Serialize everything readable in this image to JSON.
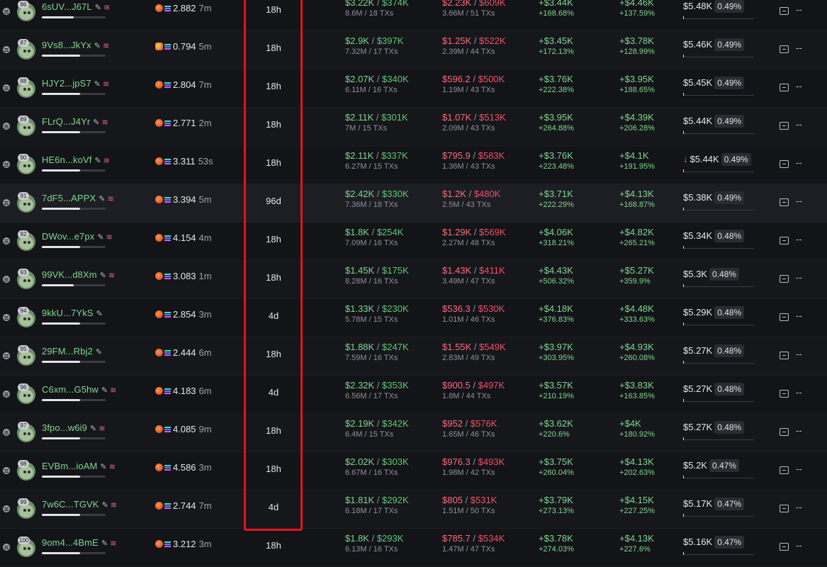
{
  "rows": [
    {
      "rank": "86",
      "wallet": "6sUV...J67L",
      "stack": true,
      "bar_pct": 0.5,
      "balance": "2.882",
      "balance_icon": "orange",
      "last_active": "7m",
      "holding": "18h",
      "bought": "$3.22K",
      "bought_total": "$374K",
      "bought_sub": "8.6M / 18 TXs",
      "sold": "$2.23K",
      "sold_total": "$609K",
      "sold_sub": "3.66M / 51 TXs",
      "pnl": "+$3.44K",
      "pnl_pct": "+168.68%",
      "pnl2": "+$4.46K",
      "pnl2_pct": "+137.59%",
      "mc_arrow": "",
      "mc": "$5.48K",
      "mc_pct": "0.49%"
    },
    {
      "rank": "87",
      "wallet": "9Vs8...JkYx",
      "stack": true,
      "bar_pct": 0.6,
      "balance": "0.794",
      "balance_icon": "multi",
      "last_active": "5m",
      "holding": "18h",
      "bought": "$2.9K",
      "bought_total": "$397K",
      "bought_sub": "7.32M / 17 TXs",
      "sold": "$1.25K",
      "sold_total": "$522K",
      "sold_sub": "2.39M / 44 TXs",
      "pnl": "+$3.45K",
      "pnl_pct": "+172.13%",
      "pnl2": "+$3.78K",
      "pnl2_pct": "+128.99%",
      "mc_arrow": "",
      "mc": "$5.46K",
      "mc_pct": "0.49%"
    },
    {
      "rank": "88",
      "wallet": "HJY2...jpS7",
      "stack": true,
      "bar_pct": 0.6,
      "balance": "2.804",
      "balance_icon": "orange",
      "last_active": "7m",
      "holding": "18h",
      "bought": "$2.07K",
      "bought_total": "$340K",
      "bought_sub": "6.11M / 16 TXs",
      "sold": "$596.2",
      "sold_total": "$500K",
      "sold_sub": "1.19M / 43 TXs",
      "pnl": "+$3.76K",
      "pnl_pct": "+222.38%",
      "pnl2": "+$3.95K",
      "pnl2_pct": "+188.65%",
      "mc_arrow": "",
      "mc": "$5.45K",
      "mc_pct": "0.49%"
    },
    {
      "rank": "89",
      "wallet": "FLrQ...J4Yr",
      "stack": true,
      "bar_pct": 0.6,
      "balance": "2.771",
      "balance_icon": "orange",
      "last_active": "2m",
      "holding": "18h",
      "bought": "$2.11K",
      "bought_total": "$301K",
      "bought_sub": "7M / 15 TXs",
      "sold": "$1.07K",
      "sold_total": "$513K",
      "sold_sub": "2.09M / 43 TXs",
      "pnl": "+$3.95K",
      "pnl_pct": "+264.88%",
      "pnl2": "+$4.39K",
      "pnl2_pct": "+206.28%",
      "mc_arrow": "",
      "mc": "$5.44K",
      "mc_pct": "0.49%"
    },
    {
      "rank": "90",
      "wallet": "HE6n...koVf",
      "stack": true,
      "bar_pct": 0.6,
      "balance": "3.311",
      "balance_icon": "orange",
      "last_active": "53s",
      "holding": "18h",
      "bought": "$2.11K",
      "bought_total": "$337K",
      "bought_sub": "6.27M / 15 TXs",
      "sold": "$795.9",
      "sold_total": "$583K",
      "sold_sub": "1.36M / 43 TXs",
      "pnl": "+$3.76K",
      "pnl_pct": "+223.48%",
      "pnl2": "+$4.1K",
      "pnl2_pct": "+191.95%",
      "mc_arrow": "↓",
      "mc": "$5.44K",
      "mc_pct": "0.49%"
    },
    {
      "rank": "91",
      "wallet": "7dF5...APPX",
      "stack": true,
      "bar_pct": 0.6,
      "balance": "3.394",
      "balance_icon": "orange",
      "last_active": "5m",
      "holding": "96d",
      "bought": "$2.42K",
      "bought_total": "$330K",
      "bought_sub": "7.36M / 18 TXs",
      "sold": "$1.2K",
      "sold_total": "$480K",
      "sold_sub": "2.5M / 43 TXs",
      "pnl": "+$3.71K",
      "pnl_pct": "+222.29%",
      "pnl2": "+$4.13K",
      "pnl2_pct": "+168.87%",
      "mc_arrow": "",
      "mc": "$5.38K",
      "mc_pct": "0.49%"
    },
    {
      "rank": "92",
      "wallet": "DWov...e7px",
      "stack": true,
      "bar_pct": 0.6,
      "balance": "4.154",
      "balance_icon": "orange",
      "last_active": "4m",
      "holding": "18h",
      "bought": "$1.8K",
      "bought_total": "$254K",
      "bought_sub": "7.09M / 16 TXs",
      "sold": "$1.29K",
      "sold_total": "$569K",
      "sold_sub": "2.27M / 48 TXs",
      "pnl": "+$4.06K",
      "pnl_pct": "+318.21%",
      "pnl2": "+$4.82K",
      "pnl2_pct": "+265.21%",
      "mc_arrow": "",
      "mc": "$5.34K",
      "mc_pct": "0.48%"
    },
    {
      "rank": "93",
      "wallet": "99VK...d8Xm",
      "stack": true,
      "bar_pct": 0.5,
      "balance": "3.083",
      "balance_icon": "orange",
      "last_active": "1m",
      "holding": "18h",
      "bought": "$1.45K",
      "bought_total": "$175K",
      "bought_sub": "8.28M / 16 TXs",
      "sold": "$1.43K",
      "sold_total": "$411K",
      "sold_sub": "3.49M / 47 TXs",
      "pnl": "+$4.43K",
      "pnl_pct": "+506.32%",
      "pnl2": "+$5.27K",
      "pnl2_pct": "+359.9%",
      "mc_arrow": "",
      "mc": "$5.3K",
      "mc_pct": "0.48%"
    },
    {
      "rank": "94",
      "wallet": "9kkU...7YkS",
      "stack": false,
      "bar_pct": 0.6,
      "balance": "2.854",
      "balance_icon": "orange",
      "last_active": "3m",
      "holding": "4d",
      "bought": "$1.33K",
      "bought_total": "$230K",
      "bought_sub": "5.78M / 15 TXs",
      "sold": "$536.3",
      "sold_total": "$530K",
      "sold_sub": "1.01M / 46 TXs",
      "pnl": "+$4.18K",
      "pnl_pct": "+376.83%",
      "pnl2": "+$4.48K",
      "pnl2_pct": "+333.63%",
      "mc_arrow": "",
      "mc": "$5.29K",
      "mc_pct": "0.48%"
    },
    {
      "rank": "95",
      "wallet": "29FM...Rbj2",
      "stack": false,
      "bar_pct": 0.6,
      "balance": "2.444",
      "balance_icon": "orange",
      "last_active": "6m",
      "holding": "18h",
      "bought": "$1.88K",
      "bought_total": "$247K",
      "bought_sub": "7.59M / 16 TXs",
      "sold": "$1.55K",
      "sold_total": "$549K",
      "sold_sub": "2.83M / 49 TXs",
      "pnl": "+$3.97K",
      "pnl_pct": "+303.95%",
      "pnl2": "+$4.93K",
      "pnl2_pct": "+260.08%",
      "mc_arrow": "",
      "mc": "$5.27K",
      "mc_pct": "0.48%"
    },
    {
      "rank": "96",
      "wallet": "C6xm...G5hw",
      "stack": true,
      "bar_pct": 0.6,
      "balance": "4.183",
      "balance_icon": "orange",
      "last_active": "6m",
      "holding": "4d",
      "bought": "$2.32K",
      "bought_total": "$353K",
      "bought_sub": "6.56M / 17 TXs",
      "sold": "$900.5",
      "sold_total": "$497K",
      "sold_sub": "1.8M / 44 TXs",
      "pnl": "+$3.57K",
      "pnl_pct": "+210.19%",
      "pnl2": "+$3.83K",
      "pnl2_pct": "+163.85%",
      "mc_arrow": "",
      "mc": "$5.27K",
      "mc_pct": "0.48%"
    },
    {
      "rank": "97",
      "wallet": "3fpo...w6i9",
      "stack": true,
      "bar_pct": 0.6,
      "balance": "4.085",
      "balance_icon": "orange",
      "last_active": "9m",
      "holding": "18h",
      "bought": "$2.19K",
      "bought_total": "$342K",
      "bought_sub": "6.4M / 15 TXs",
      "sold": "$952",
      "sold_total": "$576K",
      "sold_sub": "1.65M / 46 TXs",
      "pnl": "+$3.62K",
      "pnl_pct": "+220.6%",
      "pnl2": "+$4K",
      "pnl2_pct": "+180.92%",
      "mc_arrow": "",
      "mc": "$5.27K",
      "mc_pct": "0.48%"
    },
    {
      "rank": "98",
      "wallet": "EVBm...ioAM",
      "stack": true,
      "bar_pct": 0.6,
      "balance": "4.586",
      "balance_icon": "orange",
      "last_active": "3m",
      "holding": "18h",
      "bought": "$2.02K",
      "bought_total": "$303K",
      "bought_sub": "6.67M / 16 TXs",
      "sold": "$976.3",
      "sold_total": "$493K",
      "sold_sub": "1.98M / 42 TXs",
      "pnl": "+$3.75K",
      "pnl_pct": "+260.04%",
      "pnl2": "+$4.13K",
      "pnl2_pct": "+202.63%",
      "mc_arrow": "",
      "mc": "$5.2K",
      "mc_pct": "0.47%"
    },
    {
      "rank": "99",
      "wallet": "7w6C...TGVK",
      "stack": true,
      "bar_pct": 0.6,
      "balance": "2.744",
      "balance_icon": "orange",
      "last_active": "7m",
      "holding": "4d",
      "bought": "$1.81K",
      "bought_total": "$292K",
      "bought_sub": "6.18M / 17 TXs",
      "sold": "$805",
      "sold_total": "$531K",
      "sold_sub": "1.51M / 50 TXs",
      "pnl": "+$3.79K",
      "pnl_pct": "+273.13%",
      "pnl2": "+$4.15K",
      "pnl2_pct": "+227.25%",
      "mc_arrow": "",
      "mc": "$5.17K",
      "mc_pct": "0.47%"
    },
    {
      "rank": "100",
      "wallet": "9om4...4BmE",
      "stack": true,
      "bar_pct": 0.6,
      "balance": "3.212",
      "balance_icon": "orange",
      "last_active": "3m",
      "holding": "18h",
      "bought": "$1.8K",
      "bought_total": "$293K",
      "bought_sub": "6.13M / 16 TXs",
      "sold": "$785.7",
      "sold_total": "$534K",
      "sold_sub": "1.47M / 47 TXs",
      "pnl": "+$3.78K",
      "pnl_pct": "+274.03%",
      "pnl2": "+$4.13K",
      "pnl2_pct": "+227.6%",
      "mc_arrow": "",
      "mc": "$5.16K",
      "mc_pct": "0.47%"
    }
  ],
  "separator": " / ",
  "empty_value": "--",
  "colors": {
    "highlight": "#e3141c",
    "green": "#7fd78f",
    "red": "#ff6a7e"
  }
}
